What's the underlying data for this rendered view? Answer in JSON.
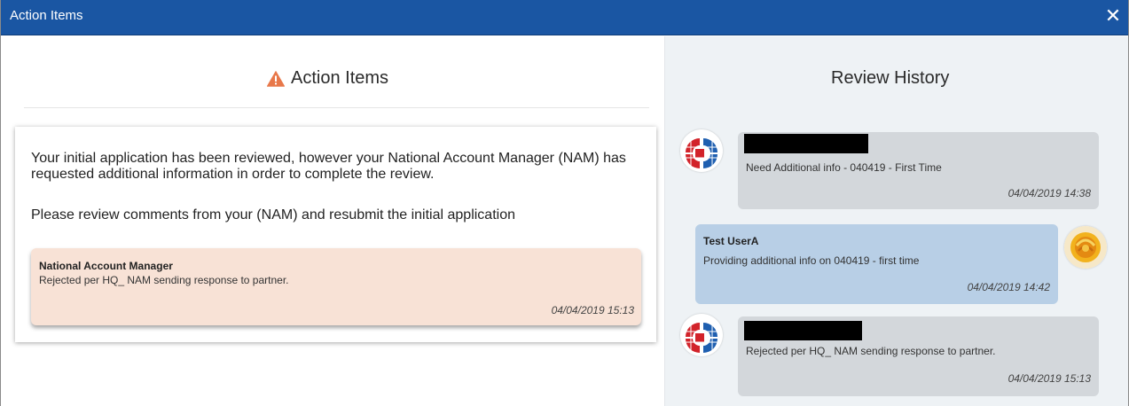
{
  "window": {
    "title": "Action Items",
    "close_label": "✕"
  },
  "action_items": {
    "heading": "Action Items",
    "notice_line1": "Your initial application has been reviewed, however your National Account Manager (NAM) has requested additional information in order to complete the review.",
    "notice_line2": "Please review comments from your (NAM) and resubmit the initial application",
    "comment": {
      "author": "National Account Manager",
      "message": "Rejected per HQ_ NAM sending response to partner.",
      "timestamp": "04/04/2019 15:13"
    }
  },
  "review_history": {
    "heading": "Review History",
    "entries": [
      {
        "author": "",
        "message": "Need Additional info - 040419 - First Time",
        "timestamp": "04/04/2019 14:38"
      },
      {
        "author": "Test UserA",
        "message": "Providing additional info on 040419 - first time",
        "timestamp": "04/04/2019 14:42"
      },
      {
        "author": "",
        "message": "Rejected per HQ_ NAM sending response to partner.",
        "timestamp": "04/04/2019 15:13"
      }
    ]
  },
  "colors": {
    "titlebar": "#1a56a3",
    "warning": "#e8784a",
    "comment_bg": "#f8e2d6",
    "bubble_grey": "#d3d7db",
    "bubble_blue": "#b8cfe6"
  },
  "icons": {
    "warning": "warning-triangle-icon",
    "close": "close-icon",
    "nam_avatar": "organization-logo-avatar",
    "user_avatar": "rose-avatar"
  }
}
